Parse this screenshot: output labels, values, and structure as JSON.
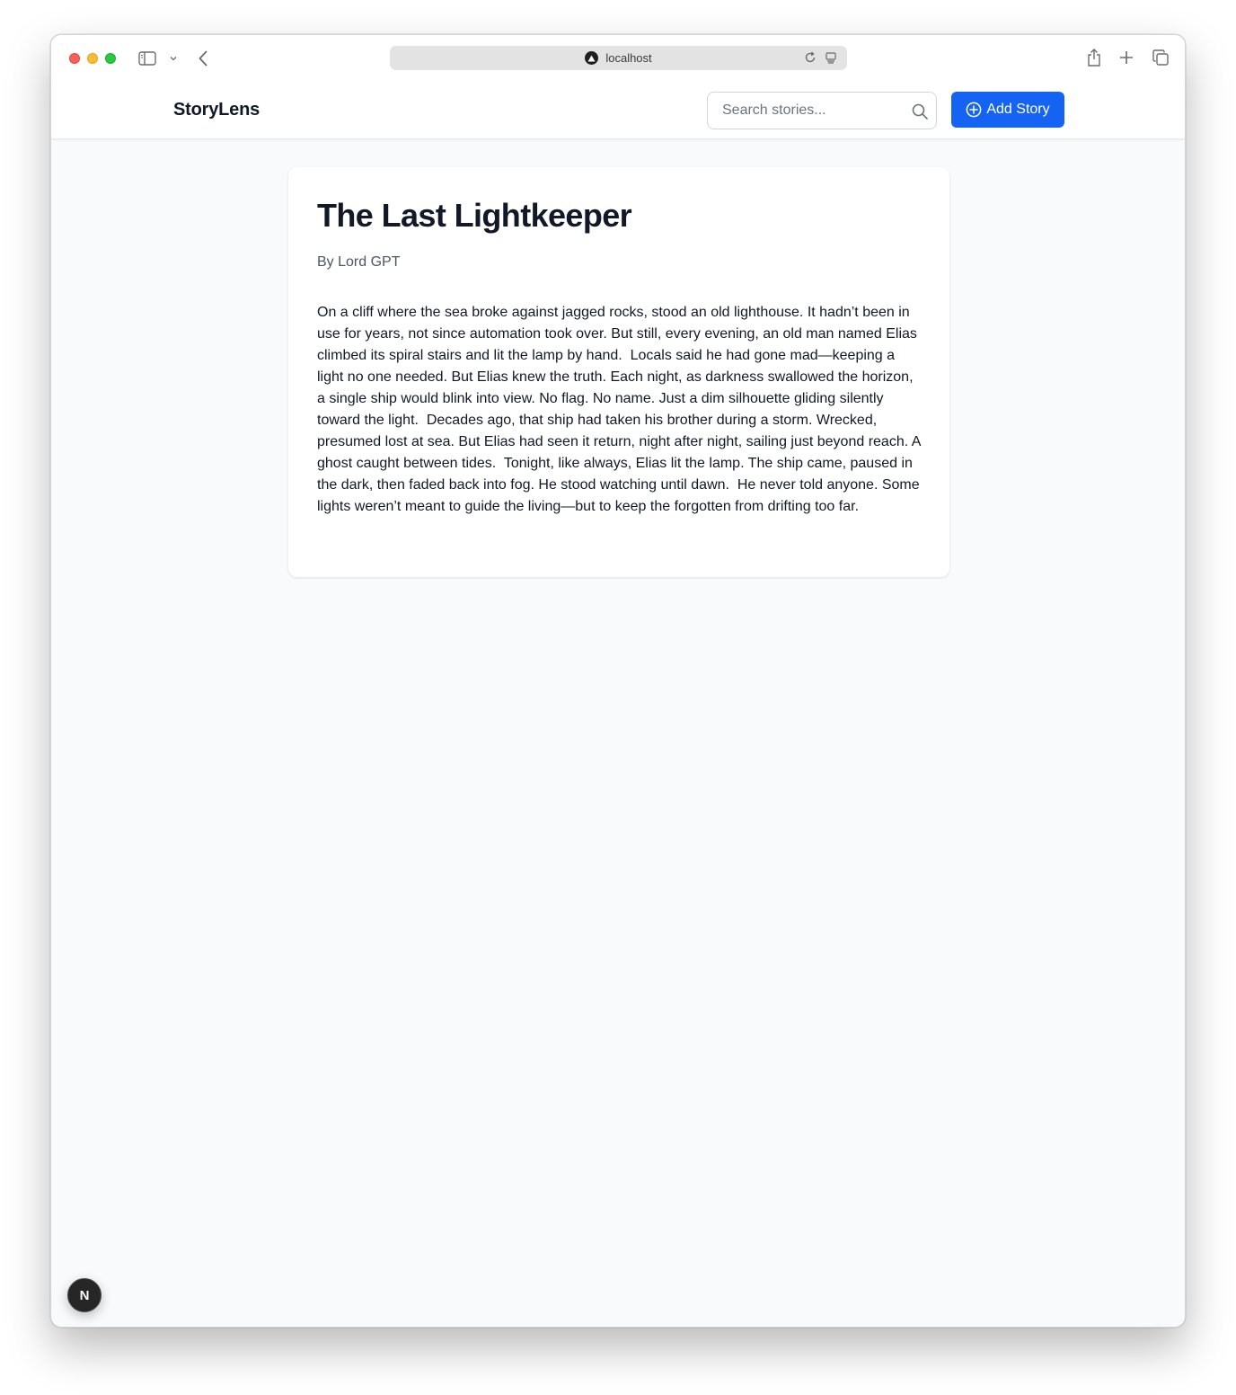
{
  "browser": {
    "url": "localhost"
  },
  "header": {
    "brand": "StoryLens",
    "search_placeholder": "Search stories...",
    "add_button_label": "Add Story"
  },
  "story": {
    "title": "The Last Lightkeeper",
    "byline": "By Lord GPT",
    "body": "On a cliff where the sea broke against jagged rocks, stood an old lighthouse. It hadn’t been in use for years, not since automation took over. But still, every evening, an old man named Elias climbed its spiral stairs and lit the lamp by hand.  Locals said he had gone mad—keeping a light no one needed. But Elias knew the truth. Each night, as darkness swallowed the horizon, a single ship would blink into view. No flag. No name. Just a dim silhouette gliding silently toward the light.  Decades ago, that ship had taken his brother during a storm. Wrecked, presumed lost at sea. But Elias had seen it return, night after night, sailing just beyond reach. A ghost caught between tides.  Tonight, like always, Elias lit the lamp. The ship came, paused in the dark, then faded back into fog. He stood watching until dawn.  He never told anyone. Some lights weren’t meant to guide the living—but to keep the forgotten from drifting too far."
  },
  "dev_indicator": {
    "label": "N"
  },
  "colors": {
    "accent": "#1463f3",
    "page_background": "#f9fafb",
    "text_primary": "#111827",
    "text_secondary": "#4b5563"
  },
  "icons": {
    "sidebar": "sidebar-icon",
    "back": "chevron-left-icon",
    "reload": "reload-icon",
    "share": "share-icon",
    "new_tab": "plus-icon",
    "tabs": "tab-overview-icon",
    "search": "search-icon",
    "add": "plus-circle-icon"
  }
}
